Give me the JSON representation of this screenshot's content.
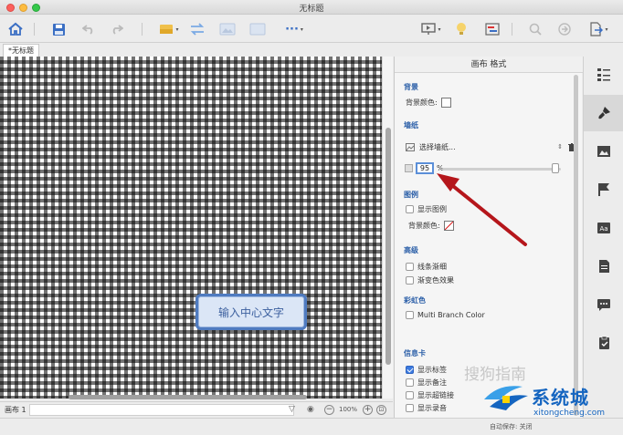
{
  "window": {
    "title": "无标题"
  },
  "toolbar": {
    "buttons": [
      "home-icon",
      "save-icon",
      "undo-icon",
      "redo-icon",
      "style-icon",
      "relationship-icon",
      "image-icon",
      "more-icon",
      "presentation-icon",
      "idea-icon",
      "gantt-icon",
      "search-icon",
      "share-icon",
      "export-icon"
    ],
    "more_label": "···"
  },
  "doc_tab": {
    "label": "*无标题"
  },
  "canvas": {
    "central_topic": "输入中心文字"
  },
  "statusbar": {
    "sheet_label": "画布 1",
    "zoom": "100%",
    "zoom_in": "+",
    "zoom_out": "−"
  },
  "panel": {
    "title": "画布 格式",
    "background": {
      "heading": "背景",
      "color_label": "背景颜色:"
    },
    "wallpaper": {
      "heading": "墙纸",
      "select_label": "选择墙纸...",
      "opacity_value": "95",
      "opacity_unit": "%",
      "opacity_level": 0.95
    },
    "legend": {
      "heading": "图例",
      "show_label": "显示图例",
      "bg_color_label": "背景颜色:"
    },
    "advanced": {
      "heading": "高级",
      "taper_label": "线条渐细",
      "gradient_label": "渐变色效果"
    },
    "rainbow": {
      "heading": "彩虹色",
      "multi_branch_label": "Multi Branch Color"
    },
    "cards": {
      "heading": "信息卡",
      "show_labels": "显示标签",
      "show_notes": "显示备注",
      "show_hyperlinks": "显示超链接",
      "show_audio": "显示录音"
    }
  },
  "footer": {
    "autosave": "自动保存: 关闭"
  },
  "watermark": {
    "brand": "系统城",
    "url": "xitongcheng.com",
    "sogou": "搜狗指南"
  },
  "colors": {
    "accent": "#2b5fa8",
    "topic_border": "#4f7bc0",
    "arrow": "#b5161b"
  }
}
